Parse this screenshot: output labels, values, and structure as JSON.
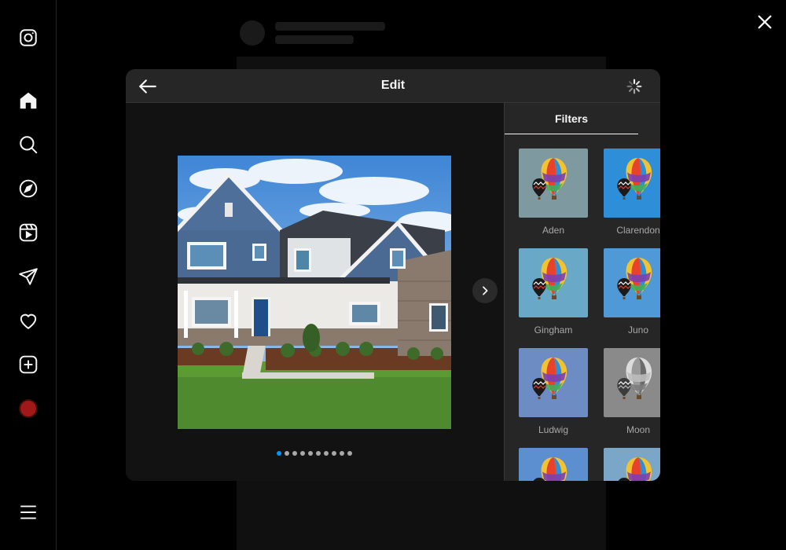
{
  "modal": {
    "title": "Edit",
    "tab_label": "Filters"
  },
  "nav": {
    "items": [
      {
        "icon": "instagram-logo-icon"
      },
      {
        "icon": "home-icon"
      },
      {
        "icon": "search-icon"
      },
      {
        "icon": "explore-compass-icon"
      },
      {
        "icon": "reels-icon"
      },
      {
        "icon": "messages-send-icon"
      },
      {
        "icon": "notifications-heart-icon"
      },
      {
        "icon": "create-plus-icon"
      },
      {
        "icon": "profile-avatar"
      },
      {
        "icon": "more-menu-icon"
      }
    ]
  },
  "carousel": {
    "total_slides": 10,
    "active_index": 0
  },
  "filters": [
    {
      "name": "Aden",
      "sky": "#7e9aa0",
      "mono": false
    },
    {
      "name": "Clarendon",
      "sky": "#2e8fd8",
      "mono": false
    },
    {
      "name": "Gingham",
      "sky": "#6aa8c8",
      "mono": false
    },
    {
      "name": "Juno",
      "sky": "#4f9ad6",
      "mono": false
    },
    {
      "name": "Ludwig",
      "sky": "#6e8cc4",
      "mono": false
    },
    {
      "name": "Moon",
      "sky": "#8a8a8a",
      "mono": true
    },
    {
      "name": "",
      "sky": "#5c8fd0",
      "mono": false
    },
    {
      "name": "",
      "sky": "#7aa6c8",
      "mono": false
    }
  ],
  "colors": {
    "accent": "#0095f6",
    "modal_bg": "#262626",
    "avatar": "#a11818"
  }
}
